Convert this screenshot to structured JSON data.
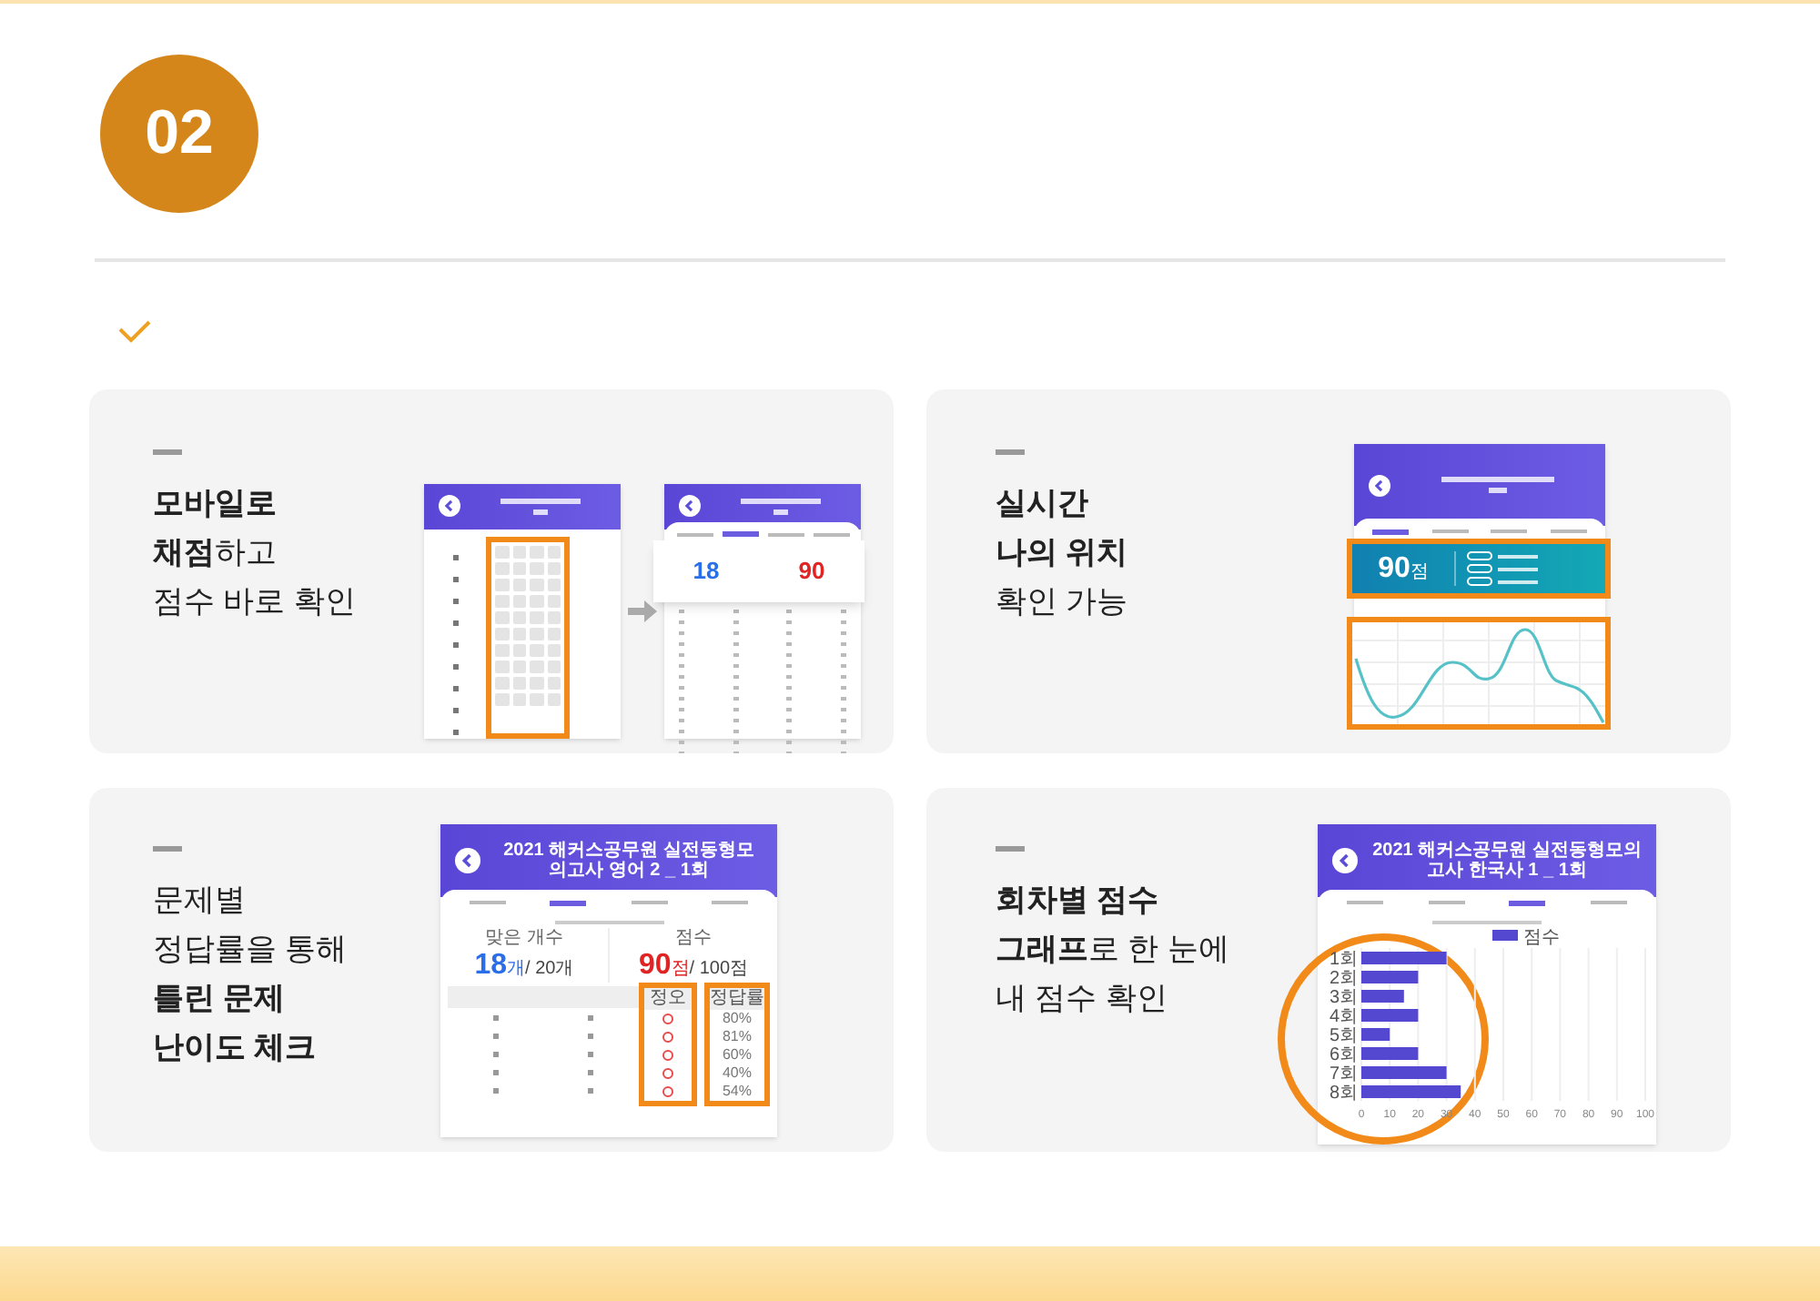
{
  "badge": "02",
  "cards": [
    {
      "kind": "scoring",
      "lines": [
        "**모바일로**",
        "**채점**하고",
        "점수 바로 확인"
      ],
      "correct": "18",
      "score": "90"
    },
    {
      "kind": "position",
      "lines": [
        "**실시간**",
        "**나의 위치**",
        "확인 가능"
      ],
      "score": "90",
      "score_unit": "점"
    },
    {
      "kind": "answers",
      "lines": [
        "문제별",
        "정답률을 통해",
        "**틀린 문제**",
        "**난이도 체크**"
      ],
      "title": "2021 해커스공무원 실전동형모의고사 영어 2 _ 1회",
      "correct_label": "맞은 개수",
      "correct": "18",
      "correct_unit": "개",
      "correct_total": "/ 20개",
      "score_label": "점수",
      "score": "90",
      "score_unit": "점",
      "score_total": "/ 100점",
      "columns": [
        "정오",
        "정답률"
      ],
      "rates": [
        "80%",
        "81%",
        "60%",
        "40%",
        "54%"
      ]
    },
    {
      "kind": "history",
      "lines": [
        "**회차별 점수**",
        "**그래프**로 한 눈에",
        "내 점수 확인"
      ],
      "title": "2021 해커스공무원 실전동형모의고사 한국사 1 _ 1회",
      "chart_data": {
        "type": "bar",
        "orientation": "horizontal",
        "grid": true,
        "categories": [
          "1회",
          "2회",
          "3회",
          "4회",
          "5회",
          "6회",
          "7회",
          "8회"
        ],
        "series": [
          {
            "name": "점수",
            "color": "#5548d0",
            "values": [
              30,
              20,
              15,
              20,
              10,
              20,
              30,
              35
            ]
          }
        ],
        "xlim": [
          0,
          100
        ],
        "xticks": [
          0,
          10,
          20,
          30,
          40,
          50,
          60,
          70,
          80,
          90,
          100
        ]
      }
    }
  ]
}
